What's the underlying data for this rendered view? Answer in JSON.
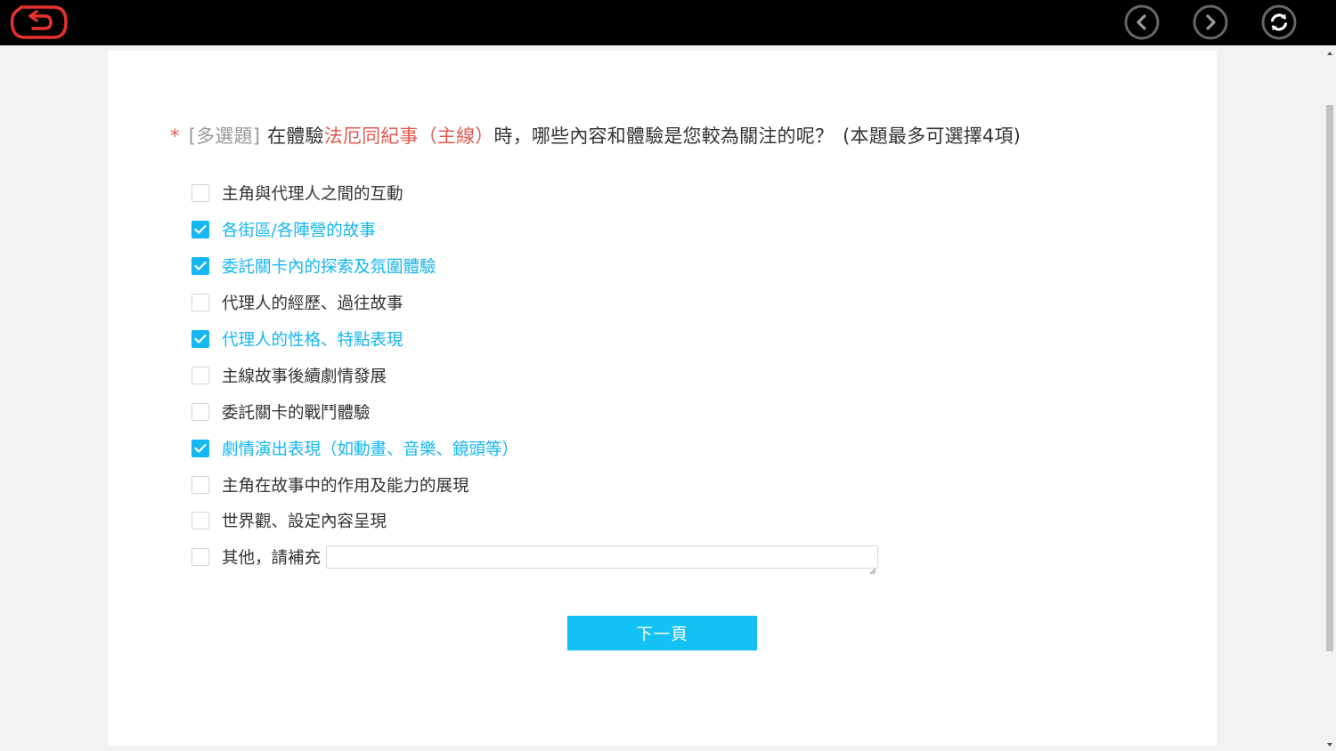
{
  "toolbar": {
    "back_icon": "back-arrow-icon",
    "prev_icon": "chevron-left-icon",
    "next_icon": "chevron-right-icon",
    "refresh_icon": "refresh-icon",
    "accent_color": "#e8312f"
  },
  "question": {
    "required_mark": "*",
    "type_label": "[多選題]",
    "text_before": "在體驗",
    "highlight": "法厄同紀事（主線）",
    "text_after": "時，哪些內容和體驗是您較為關注的呢？",
    "note": "(本題最多可選擇4項)"
  },
  "options": [
    {
      "label": "主角與代理人之間的互動",
      "checked": false
    },
    {
      "label": "各街區/各陣營的故事",
      "checked": true
    },
    {
      "label": "委託關卡內的探索及氛圍體驗",
      "checked": true
    },
    {
      "label": "代理人的經歷、過往故事",
      "checked": false
    },
    {
      "label": "代理人的性格、特點表現",
      "checked": true
    },
    {
      "label": "主線故事後續劇情發展",
      "checked": false
    },
    {
      "label": "委託關卡的戰鬥體驗",
      "checked": false
    },
    {
      "label": "劇情演出表現（如動畫、音樂、鏡頭等）",
      "checked": true
    },
    {
      "label": "主角在故事中的作用及能力的展現",
      "checked": false
    },
    {
      "label": "世界觀、設定內容呈現",
      "checked": false
    }
  ],
  "other_option": {
    "label": "其他，請補充",
    "checked": false,
    "value": ""
  },
  "next_button": {
    "label": "下一頁"
  },
  "colors": {
    "checked": "#14b6f3",
    "button": "#13c1f5",
    "highlight": "#e05a4f"
  }
}
